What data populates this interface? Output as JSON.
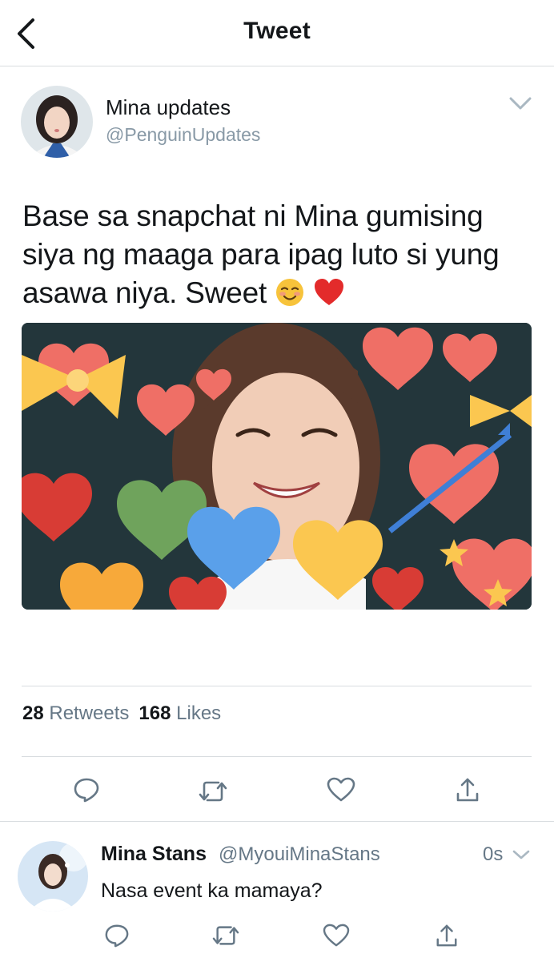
{
  "nav": {
    "title": "Tweet"
  },
  "tweet": {
    "author_name": "Mina updates",
    "author_handle": "@PenguinUpdates",
    "text": "Base sa snapchat ni Mina gumising siya ng maaga para ipag luto si yung asawa niya. Sweet",
    "emojis": [
      "smiling-face-icon",
      "red-heart-icon"
    ],
    "retweets_count": "28",
    "retweets_label": "Retweets",
    "likes_count": "168",
    "likes_label": "Likes"
  },
  "reply": {
    "author_name": "Mina Stans",
    "author_handle": "@MyouiMinaStans",
    "time": "0s",
    "text": "Nasa event ka mamaya?"
  },
  "colors": {
    "text": "#14171a",
    "secondary": "#657786",
    "handle": "#8899a6",
    "divider": "#d9dde0",
    "icon": "#657786"
  }
}
